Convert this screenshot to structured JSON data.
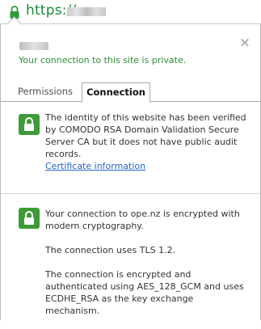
{
  "url_bar": {
    "scheme": "https://",
    "lock_icon": "lock-icon",
    "color_secure": "#1a8a3e"
  },
  "popup": {
    "close_label": "×",
    "private_message": "Your connection to this site is private.",
    "tabs": [
      {
        "label": "Permissions",
        "active": false
      },
      {
        "label": "Connection",
        "active": true
      }
    ],
    "identity": {
      "icon": "lock-icon",
      "text": "The identity of this website has been verified by COMODO RSA Domain Validation Secure Server CA but it does not have public audit records.",
      "link": "Certificate information"
    },
    "encryption": {
      "icon": "lock-icon",
      "p1": "Your connection to ope.nz is encrypted with modern cryptography.",
      "p2": "The connection uses TLS 1.2.",
      "p3": "The connection is encrypted and authenticated using AES_128_GCM and uses ECDHE_RSA as the key exchange mechanism."
    }
  },
  "colors": {
    "link": "#2764c4",
    "secure_green": "#2d8f3a",
    "lock_badge": "#3f9b37"
  }
}
